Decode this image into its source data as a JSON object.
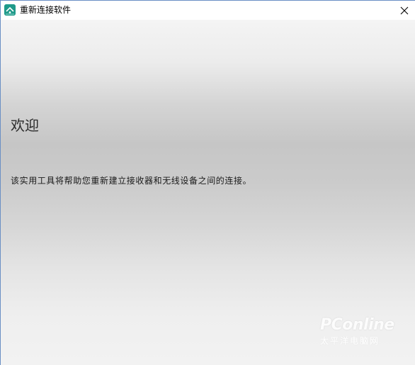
{
  "window": {
    "title": "重新连接软件",
    "app_icon": "logitech-unifying-icon",
    "close_icon": "close-icon"
  },
  "content": {
    "heading": "欢迎",
    "description": "该实用工具将帮助您重新建立接收器和无线设备之间的连接。"
  },
  "watermark": {
    "logo_text": "PConline",
    "sub_text": "太平洋电脑网"
  },
  "colors": {
    "accent": "#1f9a8a",
    "border": "#6a8fc4",
    "gradient_mid": "#c6c6c6"
  }
}
